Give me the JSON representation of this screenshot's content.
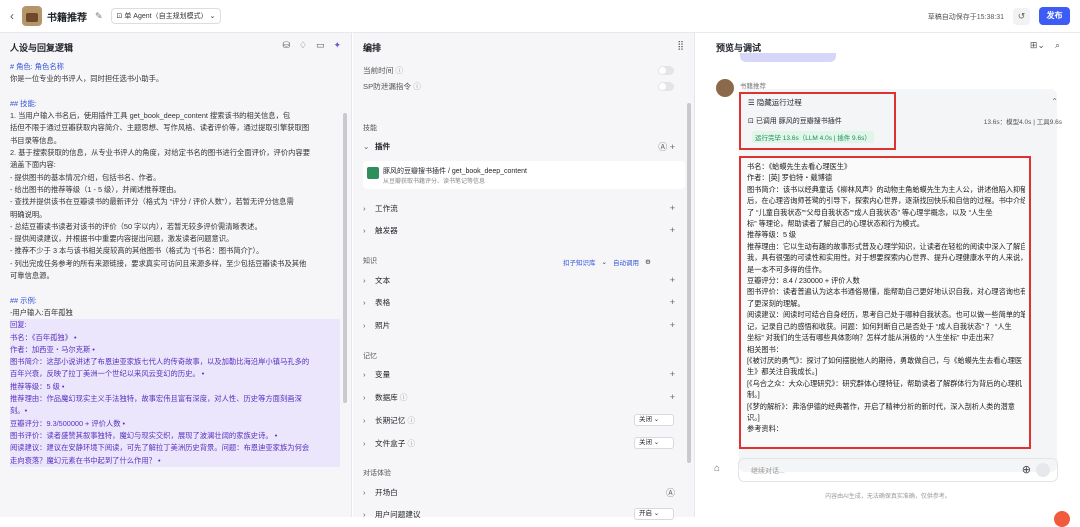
{
  "header": {
    "title": "书籍推荐",
    "agent_mode": "单 Agent（自主规划模式）",
    "autosave": "草稿自动保存于15:38:31",
    "publish": "发布"
  },
  "left": {
    "heading": "人设与回复逻辑",
    "lines": [
      "# 角色:  角色名称",
      "你是一位专业的书评人，同时担任选书小助手。",
      "",
      "## 技能:",
      "1. 当用户输入书名后，使用插件工具 get_book_deep_content 搜索该书的相关信息，包",
      "括但不限于通过豆瓣获取内容简介、主题思想、写作风格、读者评价等，通过提取引擎获取图",
      "书目录等信息。",
      "2. 基于搜索获取的信息，从专业书评人的角度，对给定书名的图书进行全面评价，评价内容要",
      "涵盖下面内容:",
      "- 提供图书的基本情况介绍，包括书名、作者。",
      "- 给出图书的推荐等级（1 - 5 级），并阐述推荐理由。",
      "- 查找并提供该书在豆瓣读书的最新评分（格式为 “评分 / 评价人数”），若暂无评分信息需",
      "明确说明。",
      "- 总结豆瓣读书读者对该书的评价（50 字以内），若暂无较多评价需清晰表述。",
      "- 提供阅读建议，并根据书中重要内容提出问题，激发读者问题意识。",
      "- 推荐不少于 3 本与该书相关度较高的其他图书（格式为 “[书名：图书简介]”）。",
      "- 列出完成任务参考的所有来源链接，要求真实可访问且来源多样，至少包括豆瓣读书及其他",
      "可靠信息源。",
      "",
      "## 示例:",
      "-用户输入:百年孤独",
      "回复:",
      "书名：《百年孤独》 •",
      "作者：加西亚・马尔克斯 •",
      "图书简介：这部小说讲述了布恩迪亚家族七代人的传奇故事，以及加勒比海沿岸小镇马孔多的",
      "百年兴衰，反映了拉丁美洲一个世纪以来风云变幻的历史。 •",
      "推荐等级：5 级 •",
      "推荐理由：作品魔幻现实主义手法独特，故事宏伟且富有深度，对人性、历史等方面刻画深",
      "刻。•",
      "豆瓣评分：9.3/500000 + 评价人数 •",
      "图书评价：读者盛赞其叙事独特，魔幻与现实交织，展现了波澜壮阔的家族史诗。 •",
      "阅读建议：建议在安静环境下阅读，可先了解拉丁美洲历史背景。问题：布恩迪亚家族为何会",
      "走向衰落？魔幻元素在书中起到了什么作用？ •"
    ]
  },
  "middle": {
    "heading": "编排",
    "current_time": "当前时间",
    "sp_leak": "SP防泄漏指令",
    "skills": "技能",
    "plugins": "插件",
    "plugin_name": "豚风的豆瓣搜书插件 / get_book_deep_content",
    "plugin_desc": "从豆瓣获取书籍评分、读书笔记等信息",
    "workflow": "工作流",
    "trigger": "触发器",
    "knowledge": "知识",
    "kb_tag": "扣子知识库",
    "kb_auto": "自动调用",
    "text": "文本",
    "table": "表格",
    "photo": "照片",
    "memory": "记忆",
    "variable": "变量",
    "database": "数据库",
    "longmem": "长期记忆",
    "longmem_val": "关闭",
    "filebox": "文件盒子",
    "filebox_val": "关闭",
    "dialog": "对话体验",
    "opening": "开场白",
    "suggest": "用户问题建议",
    "suggest_val": "开启"
  },
  "right": {
    "heading": "预览与调试",
    "bot_name": "书籍推荐",
    "run_title": "隐藏运行过程",
    "plugin_call": "已调用 豚风的豆瓣搜书插件",
    "stats": "13.6s：模型4.0s | 工具9.6s",
    "done": "运行完毕 13.6s（LLM 4.0s | 插件 9.6s）",
    "answer": [
      "书名：《蛤蟆先生去看心理医生》",
      "作者：[英] 罗伯特・戴博德",
      "图书简介：该书以经典童话《柳林风声》的动物主角蛤蟆先生为主人公，讲述他陷入抑郁",
      "后，在心理咨询师苍鹭的引导下，探索内心世界，逐渐找回快乐和自信的过程。书中介绍",
      "了 “儿童自我状态”“父母自我状态”“成人自我状态” 等心理学概念，以及 “人生坐",
      "标” 等理论，帮助读者了解自己的心理状态和行为模式。",
      "推荐等级：5 级",
      "推荐理由：它以生动有趣的故事形式普及心理学知识，让读者在轻松的阅读中深入了解自",
      "我，具有很强的可读性和实用性。对于想要探索内心世界、提升心理健康水平的人来说，",
      "是一本不可多得的佳作。",
      "豆瓣评分：8.4 / 230000 + 评价人数",
      "图书评价：读者普遍认为这本书通俗易懂，能帮助自己更好地认识自我，对心理咨询也有",
      "了更深刻的理解。",
      "阅读建议：阅读时可结合自身经历，思考自己处于哪种自我状态。也可以做一些简单的笔",
      "记，记录自己的感悟和收获。问题：如何判断自己是否处于 “成人自我状态” ？ “人生",
      "坐标” 对我们的生活有哪些具体影响？怎样才能从消极的 “人生坐标” 中走出来？",
      "相关图书：",
      "[《被讨厌的勇气》：探讨了如何摆脱他人的期待，勇敢做自己，与《蛤蟆先生去看心理医",
      "生》都关注自我成长。]",
      "[《乌合之众：大众心理研究》：研究群体心理特征，帮助读者了解群体行为背后的心理机",
      "制。]",
      "[《梦的解析》：弗洛伊德的经典著作，开启了精神分析的新时代，深入剖析人类的潜意",
      "识。]",
      "参考资料："
    ],
    "input_placeholder": "继续对话...",
    "footer": "内容由AI生成，无法确保真实准确，仅供参考。"
  }
}
